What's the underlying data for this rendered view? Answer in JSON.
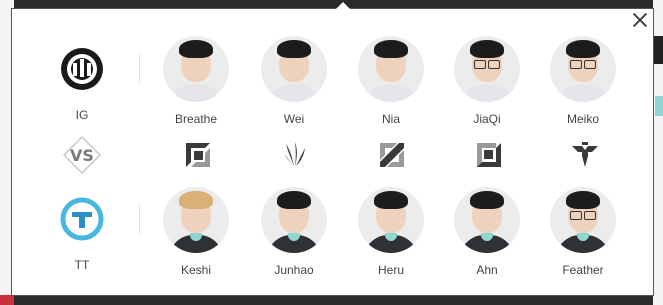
{
  "colors": {
    "overlay": "#2a2a2a",
    "popup_bg": "#ffffff",
    "avatar_bg": "#ececec",
    "tt_accent": "#49b8e0",
    "role_icon": "#3a3a3a"
  },
  "popup": {
    "close_icon": "close-icon"
  },
  "teams": {
    "top": {
      "name": "IG",
      "logo": "ig-logo"
    },
    "vs_icon": "vs-icon",
    "bottom": {
      "name": "TT",
      "logo": "tt-logo"
    }
  },
  "players_top": [
    {
      "name": "Breathe",
      "hair": "dark",
      "glasses": false
    },
    {
      "name": "Wei",
      "hair": "dark",
      "glasses": false
    },
    {
      "name": "Nia",
      "hair": "dark",
      "glasses": false
    },
    {
      "name": "JiaQi",
      "hair": "dark",
      "glasses": true
    },
    {
      "name": "Meiko",
      "hair": "dark",
      "glasses": true
    }
  ],
  "roles": [
    {
      "name": "top",
      "icon": "top-lane-icon"
    },
    {
      "name": "jungle",
      "icon": "jungle-icon"
    },
    {
      "name": "mid",
      "icon": "mid-lane-icon"
    },
    {
      "name": "bot",
      "icon": "bot-lane-icon"
    },
    {
      "name": "support",
      "icon": "support-icon"
    }
  ],
  "players_bottom": [
    {
      "name": "Keshi",
      "hair": "blond",
      "glasses": false
    },
    {
      "name": "Junhao",
      "hair": "dark",
      "glasses": false
    },
    {
      "name": "Heru",
      "hair": "dark",
      "glasses": false
    },
    {
      "name": "Ahn",
      "hair": "dark",
      "glasses": false
    },
    {
      "name": "Feather",
      "hair": "dark",
      "glasses": true
    }
  ]
}
